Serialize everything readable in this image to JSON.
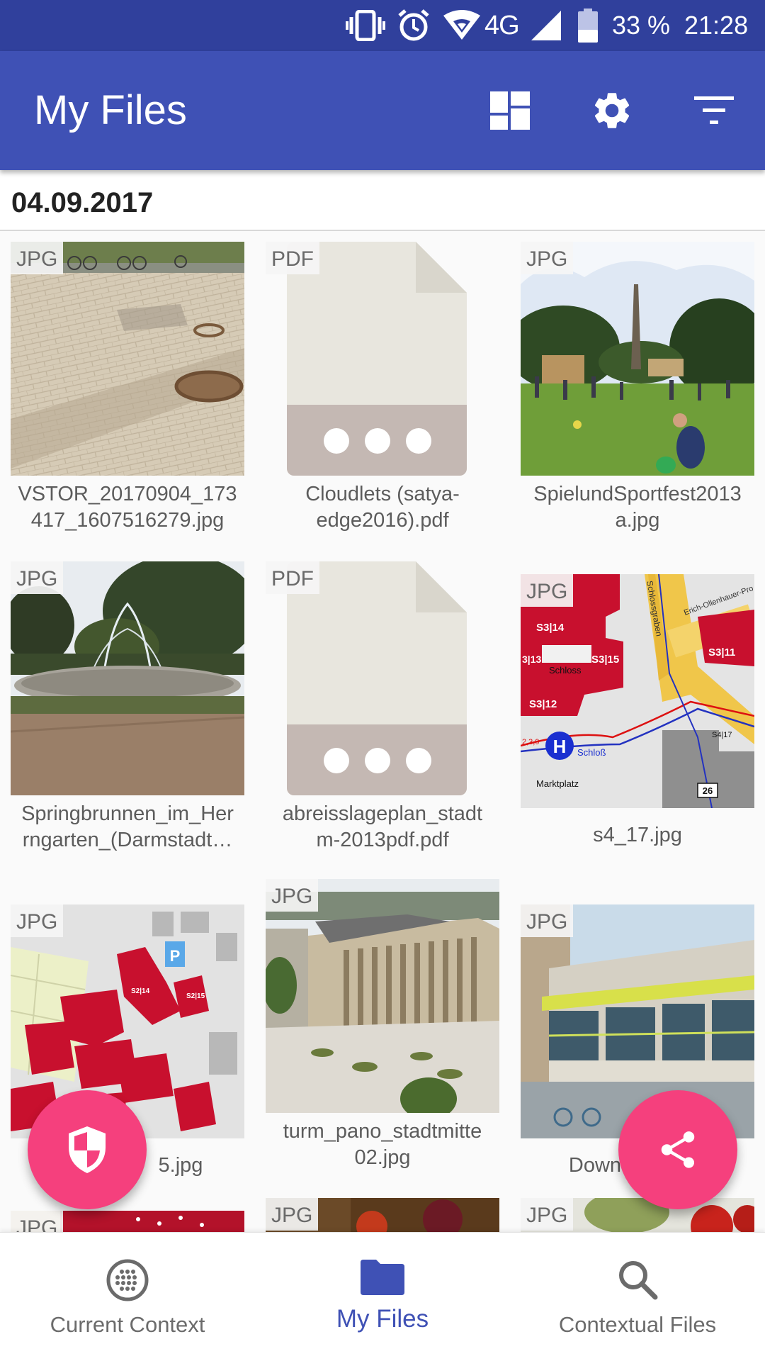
{
  "status_bar": {
    "battery_text": "33 %",
    "time": "21:28",
    "network": "4G",
    "icons": [
      "vibrate-icon",
      "alarm-icon",
      "wifi-icon",
      "signal-icon",
      "battery-icon"
    ]
  },
  "app_bar": {
    "title": "My Files",
    "actions": [
      "dashboard-icon",
      "settings-icon",
      "filter-icon"
    ]
  },
  "date_header": "04.09.2017",
  "files": [
    {
      "type": "JPG",
      "name": "VSTOR_20170904_173417_1607516279.jpg",
      "caption_lines": [
        "VSTOR_20170904_173",
        "417_1607516279.jpg"
      ],
      "thumb": "paving"
    },
    {
      "type": "PDF",
      "name": "Cloudlets (satya-edge2016).pdf",
      "caption_lines": [
        "Cloudlets (satya-",
        "edge2016).pdf"
      ],
      "thumb": "pdf"
    },
    {
      "type": "JPG",
      "name": "SpielundSportfest2013a.jpg",
      "caption_lines": [
        "SpielundSportfest2013",
        "a.jpg"
      ],
      "thumb": "park"
    },
    {
      "type": "JPG",
      "name": "Springbrunnen_im_Herrngarten_(Darmstadt…",
      "caption_lines": [
        "Springbrunnen_im_Her",
        "rngarten_(Darmstadt…"
      ],
      "thumb": "fountain"
    },
    {
      "type": "PDF",
      "name": "abreisslageplan_stadtm-2013pdf.pdf",
      "caption_lines": [
        "abreisslageplan_stadt",
        "m-2013pdf.pdf"
      ],
      "thumb": "pdf"
    },
    {
      "type": "JPG",
      "name": "s4_17.jpg",
      "caption_lines": [
        "s4_17.jpg"
      ],
      "thumb": "map1"
    },
    {
      "type": "JPG",
      "name": "…5.jpg",
      "caption_lines": [
        "5.jpg"
      ],
      "thumb": "map2"
    },
    {
      "type": "JPG",
      "name": "turm_pano_stadtmitte02.jpg",
      "caption_lines": [
        "turm_pano_stadtmitte",
        "02.jpg"
      ],
      "thumb": "aerial"
    },
    {
      "type": "JPG",
      "name": "Down…",
      "caption_lines": [
        "Down"
      ],
      "thumb": "building"
    },
    {
      "type": "JPG",
      "name": "",
      "caption_lines": [],
      "thumb": "food1"
    },
    {
      "type": "JPG",
      "name": "",
      "caption_lines": [],
      "thumb": "food2"
    },
    {
      "type": "JPG",
      "name": "",
      "caption_lines": [],
      "thumb": "food3"
    }
  ],
  "map_labels": {
    "s3_14": "S3|14",
    "s3_13": "3|13",
    "s3_15": "S3|15",
    "s3_11": "S3|11",
    "s3_12": "S3|12",
    "schloss": "Schloss",
    "schlossgraben": "Schlossgraben",
    "erich": "Erich-Ollenhauer-Pro",
    "h": "H",
    "schlob": "Schloß",
    "marktplatz": "Marktplatz",
    "n26": "26",
    "s4_17": "S4|17",
    "lines": "2,3,9",
    "s2_14": "S2|14",
    "s2_15": "S2|15",
    "p": "P"
  },
  "fabs": {
    "left": "shield-icon",
    "right": "share-icon"
  },
  "bottom_nav": [
    {
      "label": "Current Context",
      "icon": "context-icon",
      "active": false
    },
    {
      "label": "My Files",
      "icon": "folder-icon",
      "active": true
    },
    {
      "label": "Contextual Files",
      "icon": "search-icon",
      "active": false
    }
  ],
  "colors": {
    "primary": "#3f51b5",
    "primary_dark": "#30409c",
    "accent": "#f5407d"
  }
}
